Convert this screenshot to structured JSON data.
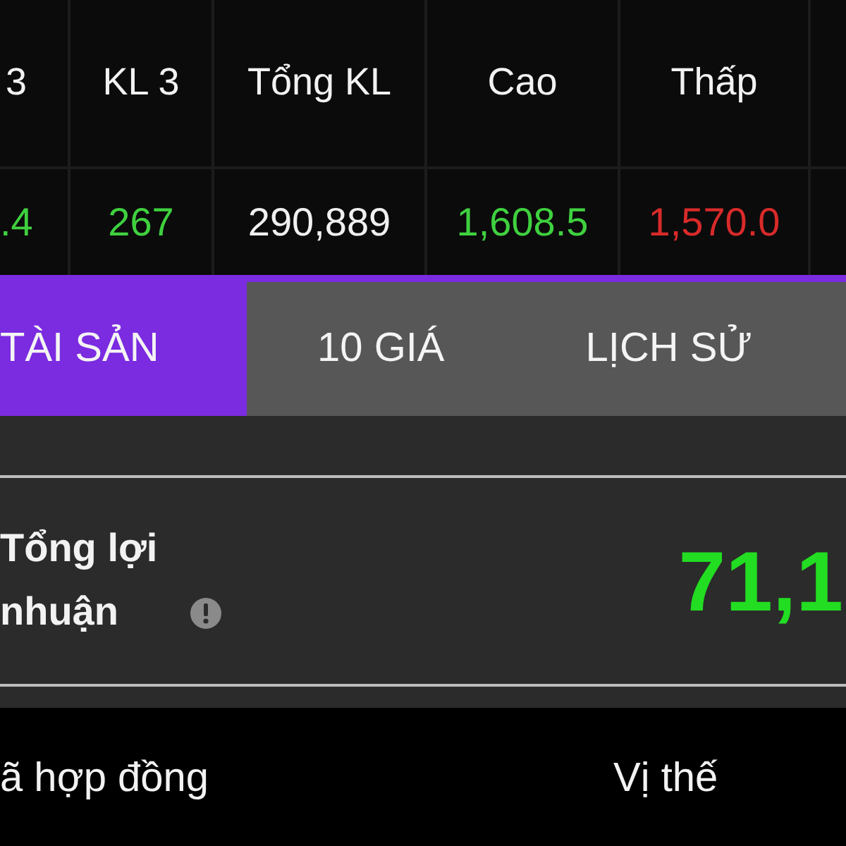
{
  "table": {
    "columns": [
      {
        "label": "3"
      },
      {
        "label": "KL 3"
      },
      {
        "label": "Tổng KL"
      },
      {
        "label": "Cao"
      },
      {
        "label": "Thấp"
      }
    ],
    "row": [
      {
        "text": ".4",
        "color": "#3fd13f"
      },
      {
        "text": "267",
        "color": "#3fd13f"
      },
      {
        "text": "290,889",
        "color": "#f0f0f0"
      },
      {
        "text": "1,608.5",
        "color": "#3fd13f"
      },
      {
        "text": "1,570.0",
        "color": "#d92a2a"
      }
    ]
  },
  "tabs": [
    {
      "label": "TÀI SẢN",
      "selected": true
    },
    {
      "label": "10 GIÁ",
      "selected": false
    },
    {
      "label": "LỊCH SỬ",
      "selected": false
    }
  ],
  "profit": {
    "label": "Tổng lợi nhuận",
    "value": "71,1"
  },
  "positions": {
    "columns": [
      "ã hợp đồng",
      "Vị thế"
    ]
  }
}
